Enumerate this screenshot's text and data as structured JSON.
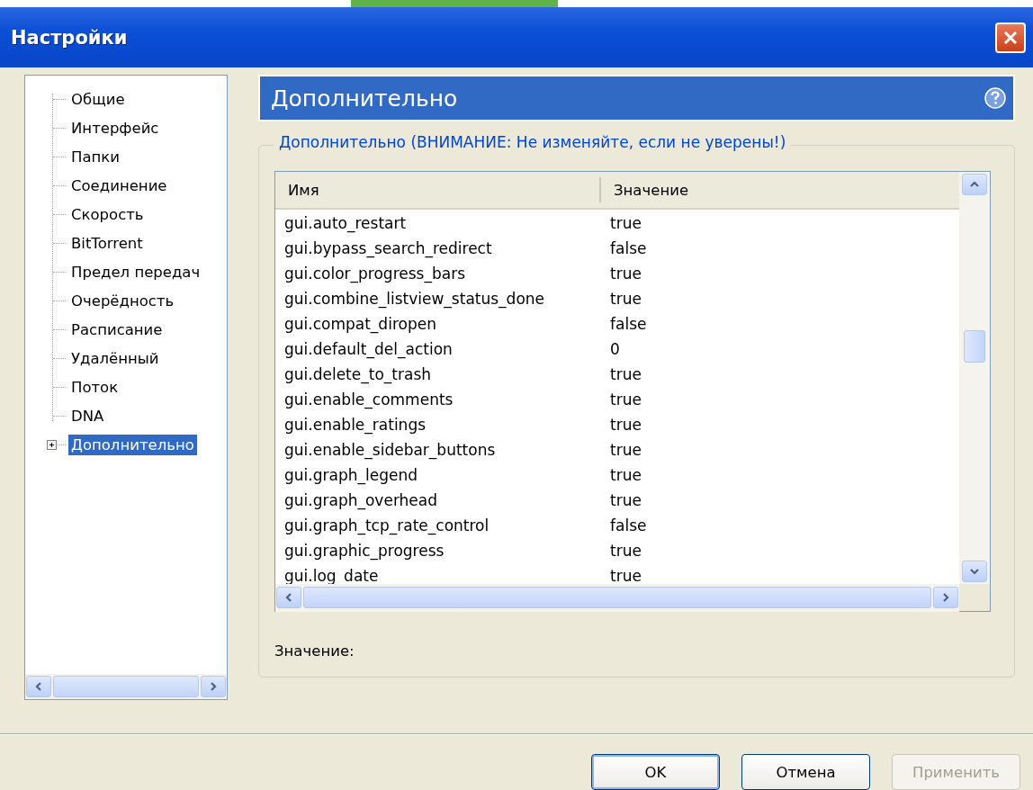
{
  "window": {
    "title": "Настройки"
  },
  "tree": {
    "items": [
      {
        "label": "Общие",
        "selected": false,
        "expandable": false
      },
      {
        "label": "Интерфейс",
        "selected": false,
        "expandable": false
      },
      {
        "label": "Папки",
        "selected": false,
        "expandable": false
      },
      {
        "label": "Соединение",
        "selected": false,
        "expandable": false
      },
      {
        "label": "Скорость",
        "selected": false,
        "expandable": false
      },
      {
        "label": "BitTorrent",
        "selected": false,
        "expandable": false
      },
      {
        "label": "Предел передач",
        "selected": false,
        "expandable": false
      },
      {
        "label": "Очерёдность",
        "selected": false,
        "expandable": false
      },
      {
        "label": "Расписание",
        "selected": false,
        "expandable": false
      },
      {
        "label": "Удалённый",
        "selected": false,
        "expandable": false
      },
      {
        "label": "Поток",
        "selected": false,
        "expandable": false
      },
      {
        "label": "DNA",
        "selected": false,
        "expandable": false
      },
      {
        "label": "Дополнительно",
        "selected": true,
        "expandable": true
      }
    ]
  },
  "panel": {
    "title": "Дополнительно",
    "group_title": "Дополнительно (ВНИМАНИЕ: Не изменяйте, если не уверены!)",
    "table": {
      "columns": [
        "Имя",
        "Значение"
      ],
      "rows": [
        [
          "gui.auto_restart",
          "true"
        ],
        [
          "gui.bypass_search_redirect",
          "false"
        ],
        [
          "gui.color_progress_bars",
          "true"
        ],
        [
          "gui.combine_listview_status_done",
          "true"
        ],
        [
          "gui.compat_diropen",
          "false"
        ],
        [
          "gui.default_del_action",
          "0"
        ],
        [
          "gui.delete_to_trash",
          "true"
        ],
        [
          "gui.enable_comments",
          "true"
        ],
        [
          "gui.enable_ratings",
          "true"
        ],
        [
          "gui.enable_sidebar_buttons",
          "true"
        ],
        [
          "gui.graph_legend",
          "true"
        ],
        [
          "gui.graph_overhead",
          "true"
        ],
        [
          "gui.graph_tcp_rate_control",
          "false"
        ],
        [
          "gui.graphic_progress",
          "true"
        ],
        [
          "gui.log_date",
          "true"
        ]
      ]
    },
    "value_label": "Значение:"
  },
  "buttons": [
    {
      "label": "OK",
      "default": true,
      "disabled": false
    },
    {
      "label": "Отмена",
      "default": false,
      "disabled": false
    },
    {
      "label": "Применить",
      "default": false,
      "disabled": true
    }
  ]
}
